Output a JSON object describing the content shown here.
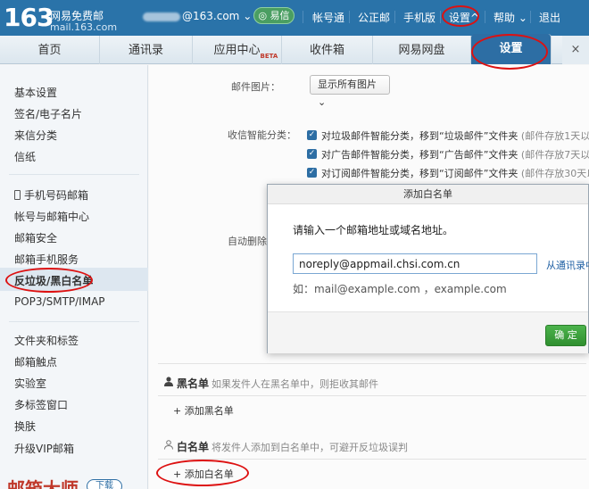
{
  "header": {
    "logo_number": "163",
    "logo_text": "网易免费邮",
    "logo_url": "mail.163.com",
    "account": "@163.com",
    "yixin": "易信",
    "nav": [
      "帐号通",
      "公正邮",
      "手机版",
      "设置",
      "帮助",
      "退出"
    ]
  },
  "tabs": [
    {
      "label": "首页"
    },
    {
      "label": "通讯录"
    },
    {
      "label": "应用中心",
      "badge": "BETA"
    },
    {
      "label": "收件箱"
    },
    {
      "label": "网易网盘"
    },
    {
      "label": "设置"
    }
  ],
  "tab_close": "×",
  "sidebar": {
    "group1": [
      "基本设置",
      "签名/电子名片",
      "来信分类",
      "信纸"
    ],
    "group2": [
      "手机号码邮箱",
      "帐号与邮箱中心",
      "邮箱安全",
      "邮箱手机服务",
      "反垃圾/黑白名单",
      "POP3/SMTP/IMAP"
    ],
    "group3": [
      "文件夹和标签",
      "邮箱触点",
      "实验室",
      "多标签窗口",
      "换肤",
      "升级VIP邮箱"
    ],
    "promo": "邮箱大师",
    "promo_button": "下载"
  },
  "main": {
    "mail_image_label": "邮件图片：",
    "mail_image_value": "显示所有图片",
    "smart_label": "收信智能分类：",
    "smart_options": [
      {
        "text": "对垃圾邮件智能分类，移到“垃圾邮件”文件夹",
        "note": "(邮件存放1天以上"
      },
      {
        "text": "对广告邮件智能分类，移到“广告邮件”文件夹",
        "note": "(邮件存放7天以上"
      },
      {
        "text": "对订阅邮件智能分类，移到“订阅邮件”文件夹",
        "note": "(邮件存放30天以上"
      }
    ],
    "auto_delete_label": "自动删除",
    "blacklist_title": "黑名单",
    "blacklist_desc": "如果发件人在黑名单中，则拒收其邮件",
    "blacklist_add": "+ 添加黑名单",
    "whitelist_title": "白名单",
    "whitelist_desc": "将发件人添加到白名单中，可避开反垃圾误判",
    "whitelist_add": "+ 添加白名单"
  },
  "modal": {
    "title": "添加白名单",
    "prompt": "请输入一个邮箱地址或域名地址。",
    "input_value": "noreply@appmail.chsi.com.cn",
    "from_contacts": "从通讯录中",
    "example": "如：mail@example.com ，example.com",
    "ok": "确 定"
  }
}
